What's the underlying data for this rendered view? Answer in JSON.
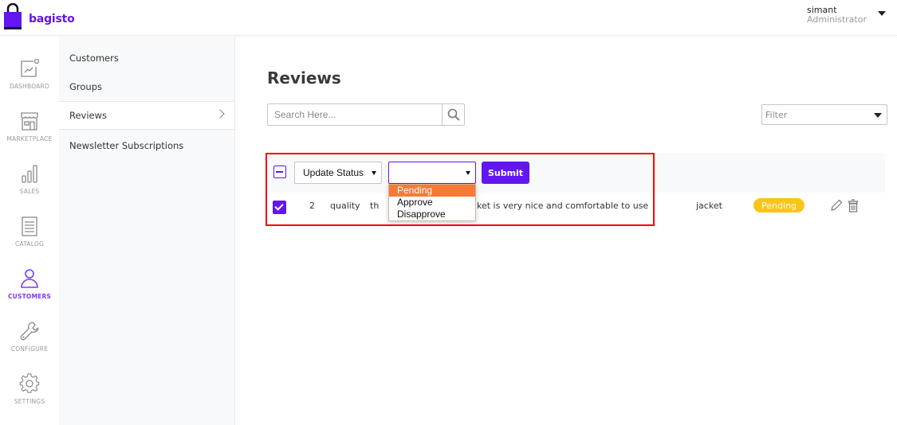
{
  "brand": {
    "name": "bagisto",
    "color": "#6216f0"
  },
  "profile": {
    "name": "simant",
    "role": "Administrator"
  },
  "rail": [
    {
      "label": "DASHBOARD",
      "icon": "dashboard-icon",
      "active": false
    },
    {
      "label": "MARKETPLACE",
      "icon": "marketplace-icon",
      "active": false
    },
    {
      "label": "SALES",
      "icon": "sales-icon",
      "active": false
    },
    {
      "label": "CATALOG",
      "icon": "catalog-icon",
      "active": false
    },
    {
      "label": "CUSTOMERS",
      "icon": "customer-icon",
      "active": true
    },
    {
      "label": "CONFIGURE",
      "icon": "wrench-icon",
      "active": false
    },
    {
      "label": "SETTINGS",
      "icon": "gear-icon",
      "active": false
    }
  ],
  "submenu": [
    {
      "label": "Customers",
      "active": false
    },
    {
      "label": "Groups",
      "active": false
    },
    {
      "label": "Reviews",
      "active": true
    },
    {
      "label": "Newsletter Subscriptions",
      "active": false
    }
  ],
  "page": {
    "title": "Reviews"
  },
  "search": {
    "placeholder": "Search Here...",
    "value": ""
  },
  "filter": {
    "label": "Filter"
  },
  "mass_action": {
    "action_label": "Update Status",
    "value_selected": "",
    "options": [
      "Pending",
      "Approve",
      "Disapprove"
    ],
    "highlighted_option": "Pending",
    "submit_label": "Submit"
  },
  "rows": [
    {
      "checked": true,
      "id": "2",
      "title": "quality",
      "comment_prefix": "th",
      "comment_suffix": "ket is very nice and comfortable to use",
      "product": "jacket",
      "status": "Pending",
      "status_color": "#fcc419"
    }
  ],
  "colors": {
    "accent": "#6216f0",
    "highlight_border": "#ff0000",
    "option_highlight": "#f47a36"
  }
}
